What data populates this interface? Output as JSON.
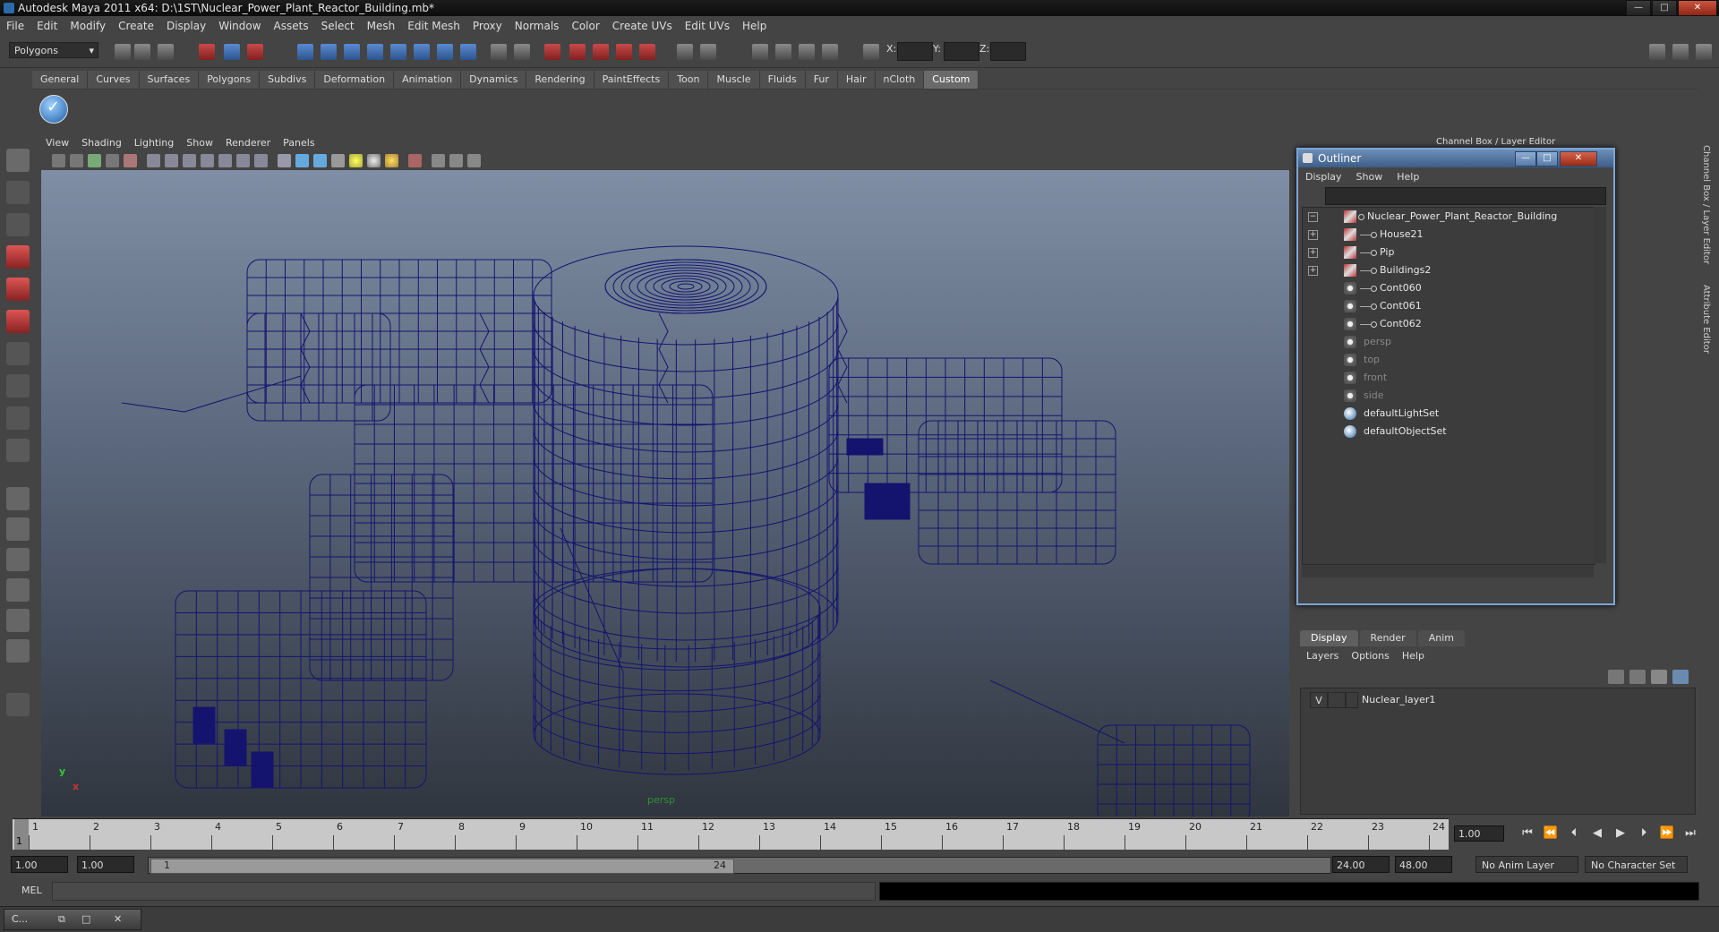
{
  "window": {
    "title": "Autodesk Maya 2011 x64: D:\\1ST\\Nuclear_Power_Plant_Reactor_Building.mb*",
    "min": "—",
    "max": "□",
    "close": "✕"
  },
  "menubar": [
    "File",
    "Edit",
    "Modify",
    "Create",
    "Display",
    "Window",
    "Assets",
    "Select",
    "Mesh",
    "Edit Mesh",
    "Proxy",
    "Normals",
    "Color",
    "Create UVs",
    "Edit UVs",
    "Help"
  ],
  "statusline": {
    "mode": "Polygons",
    "x_label": "X:",
    "y_label": "Y:",
    "z_label": "Z:"
  },
  "shelf": {
    "tabs": [
      "General",
      "Curves",
      "Surfaces",
      "Polygons",
      "Subdivs",
      "Deformation",
      "Animation",
      "Dynamics",
      "Rendering",
      "PaintEffects",
      "Toon",
      "Muscle",
      "Fluids",
      "Fur",
      "Hair",
      "nCloth",
      "Custom"
    ],
    "active": "Custom"
  },
  "viewport": {
    "menu": [
      "View",
      "Shading",
      "Lighting",
      "Show",
      "Renderer",
      "Panels"
    ],
    "camera": "persp",
    "axis_y": "y",
    "axis_x": "x",
    "wire_color": "#14146e"
  },
  "right_panel": {
    "title": "Channel Box / Layer Editor",
    "side_tab_1": "Channel Box / Layer Editor",
    "side_tab_2": "Attribute Editor"
  },
  "outliner": {
    "title": "Outliner",
    "menu": [
      "Display",
      "Show",
      "Help"
    ],
    "items": [
      {
        "label": "Nuclear_Power_Plant_Reactor_Building",
        "icon": "mesh-icon",
        "expand": "−"
      },
      {
        "label": "House21",
        "icon": "mesh-icon",
        "expand": "+"
      },
      {
        "label": "Pip",
        "icon": "mesh-icon",
        "expand": "+"
      },
      {
        "label": "Buildings2",
        "icon": "mesh-icon",
        "expand": "+"
      },
      {
        "label": "Cont060",
        "icon": "nurbs-icon"
      },
      {
        "label": "Cont061",
        "icon": "nurbs-icon"
      },
      {
        "label": "Cont062",
        "icon": "nurbs-icon"
      },
      {
        "label": "persp",
        "icon": "camera-icon"
      },
      {
        "label": "top",
        "icon": "camera-icon"
      },
      {
        "label": "front",
        "icon": "camera-icon"
      },
      {
        "label": "side",
        "icon": "camera-icon"
      },
      {
        "label": "defaultLightSet",
        "icon": "set-icon"
      },
      {
        "label": "defaultObjectSet",
        "icon": "set-icon"
      }
    ]
  },
  "layer_editor": {
    "tabs": [
      "Display",
      "Render",
      "Anim"
    ],
    "active_tab": "Display",
    "menu": [
      "Layers",
      "Options",
      "Help"
    ],
    "layers": [
      {
        "visible": "V",
        "name": "Nuclear_layer1"
      }
    ]
  },
  "time_slider": {
    "ticks": [
      "1",
      "2",
      "3",
      "4",
      "5",
      "6",
      "7",
      "8",
      "9",
      "10",
      "11",
      "12",
      "13",
      "14",
      "15",
      "16",
      "17",
      "18",
      "19",
      "20",
      "21",
      "22",
      "23",
      "24"
    ],
    "current_frame": "1",
    "current_time": "1.00"
  },
  "range": {
    "start": "1.00",
    "playback_start": "1.00",
    "thumb_start": "1",
    "thumb_end": "24",
    "playback_end": "24.00",
    "end": "48.00",
    "anim_layer": "No Anim Layer",
    "character_set": "No Character Set"
  },
  "command": {
    "label": "MEL"
  },
  "taskbar": {
    "item": "C..."
  }
}
